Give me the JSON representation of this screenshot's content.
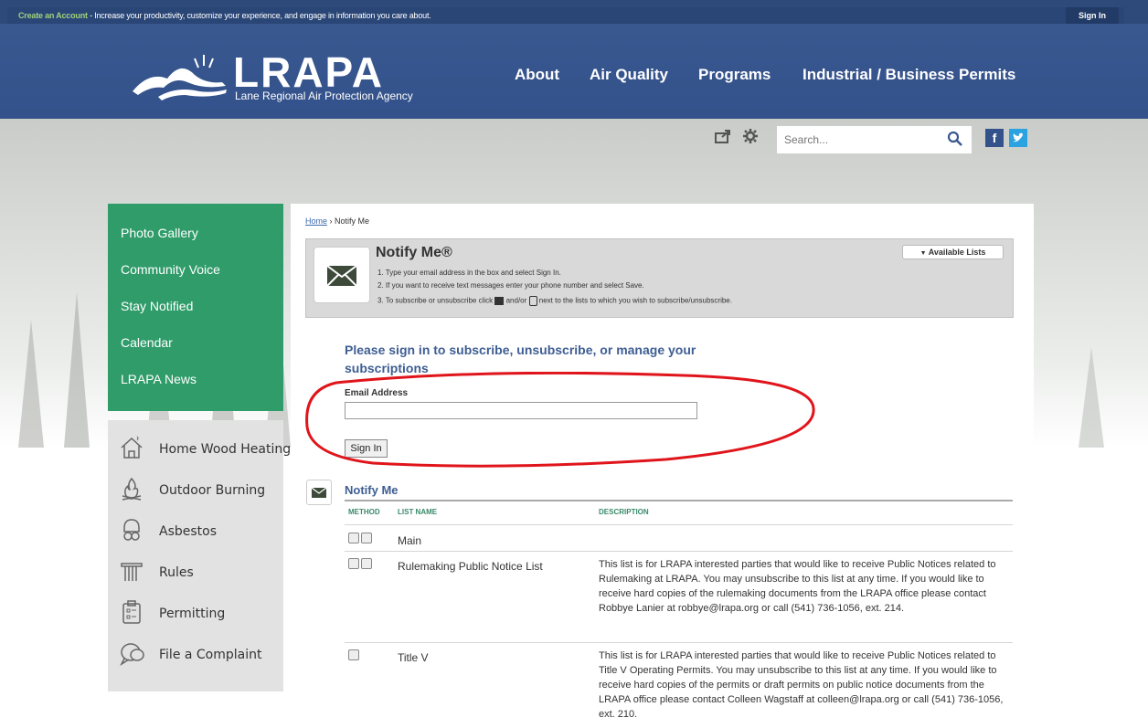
{
  "topbar": {
    "create_account": "Create an Account",
    "tagline": " - Increase your productivity, customize your experience, and engage in information you care about.",
    "sign_in": "Sign In"
  },
  "header": {
    "logo_text": "LRAPA",
    "logo_subtitle": "Lane Regional Air Protection Agency",
    "nav": [
      "About",
      "Air Quality",
      "Programs",
      "Industrial / Business Permits"
    ]
  },
  "search": {
    "placeholder": "Search..."
  },
  "social": {
    "facebook": "f",
    "twitter": "t"
  },
  "sidebar": {
    "primary": [
      "Photo Gallery",
      "Community Voice",
      "Stay Notified",
      "Calendar",
      "LRAPA News"
    ],
    "secondary": [
      {
        "label": "Home Wood Heating",
        "icon": "house-icon"
      },
      {
        "label": "Outdoor Burning",
        "icon": "fire-icon"
      },
      {
        "label": "Asbestos",
        "icon": "mask-icon"
      },
      {
        "label": "Rules",
        "icon": "column-icon"
      },
      {
        "label": "Permitting",
        "icon": "clipboard-icon"
      },
      {
        "label": "File a Complaint",
        "icon": "speech-icon"
      }
    ]
  },
  "breadcrumb": {
    "home": "Home",
    "sep": " › ",
    "current": "Notify Me"
  },
  "notify_box": {
    "title": "Notify Me®",
    "step1": "1. Type your email address in the box and select Sign In.",
    "step2": "2. If you want to receive text messages enter your phone number and select Save.",
    "step3a": "3. To subscribe or unsubscribe click",
    "step3b": "and/or",
    "step3c": "next to the lists to which you wish to subscribe/unsubscribe.",
    "available_lists": "Available Lists"
  },
  "signin_form": {
    "heading": "Please sign in to subscribe, unsubscribe, or manage your subscriptions",
    "email_label": "Email Address",
    "email_value": "",
    "button": "Sign In"
  },
  "list": {
    "title": "Notify Me",
    "columns": [
      "METHOD",
      "LIST NAME",
      "DESCRIPTION"
    ],
    "rows": [
      {
        "name": "Main",
        "description": ""
      },
      {
        "name": "Rulemaking Public Notice List",
        "description": "This list is for LRAPA interested parties that would like to receive Public Notices related to Rulemaking at LRAPA. You may unsubscribe to this list at any time. If you would like to receive hard copies of the rulemaking documents from the LRAPA office please contact Robbye Lanier at robbye@lrapa.org or call (541) 736-1056, ext. 214."
      },
      {
        "name": "Title V",
        "description": "This list is for LRAPA interested parties that would like to receive Public Notices related to Title V Operating Permits. You may unsubscribe to this list at any time. If you would like to receive hard copies of the permits or draft permits on public notice documents from the LRAPA office please contact Colleen Wagstaff at colleen@lrapa.org or call (541) 736-1056, ext. 210."
      }
    ]
  },
  "colors": {
    "header_blue": "#33518a",
    "sidebar_green": "#2f9c6a",
    "heading_blue": "#3e5e93",
    "annotation_red": "#e0151b"
  }
}
